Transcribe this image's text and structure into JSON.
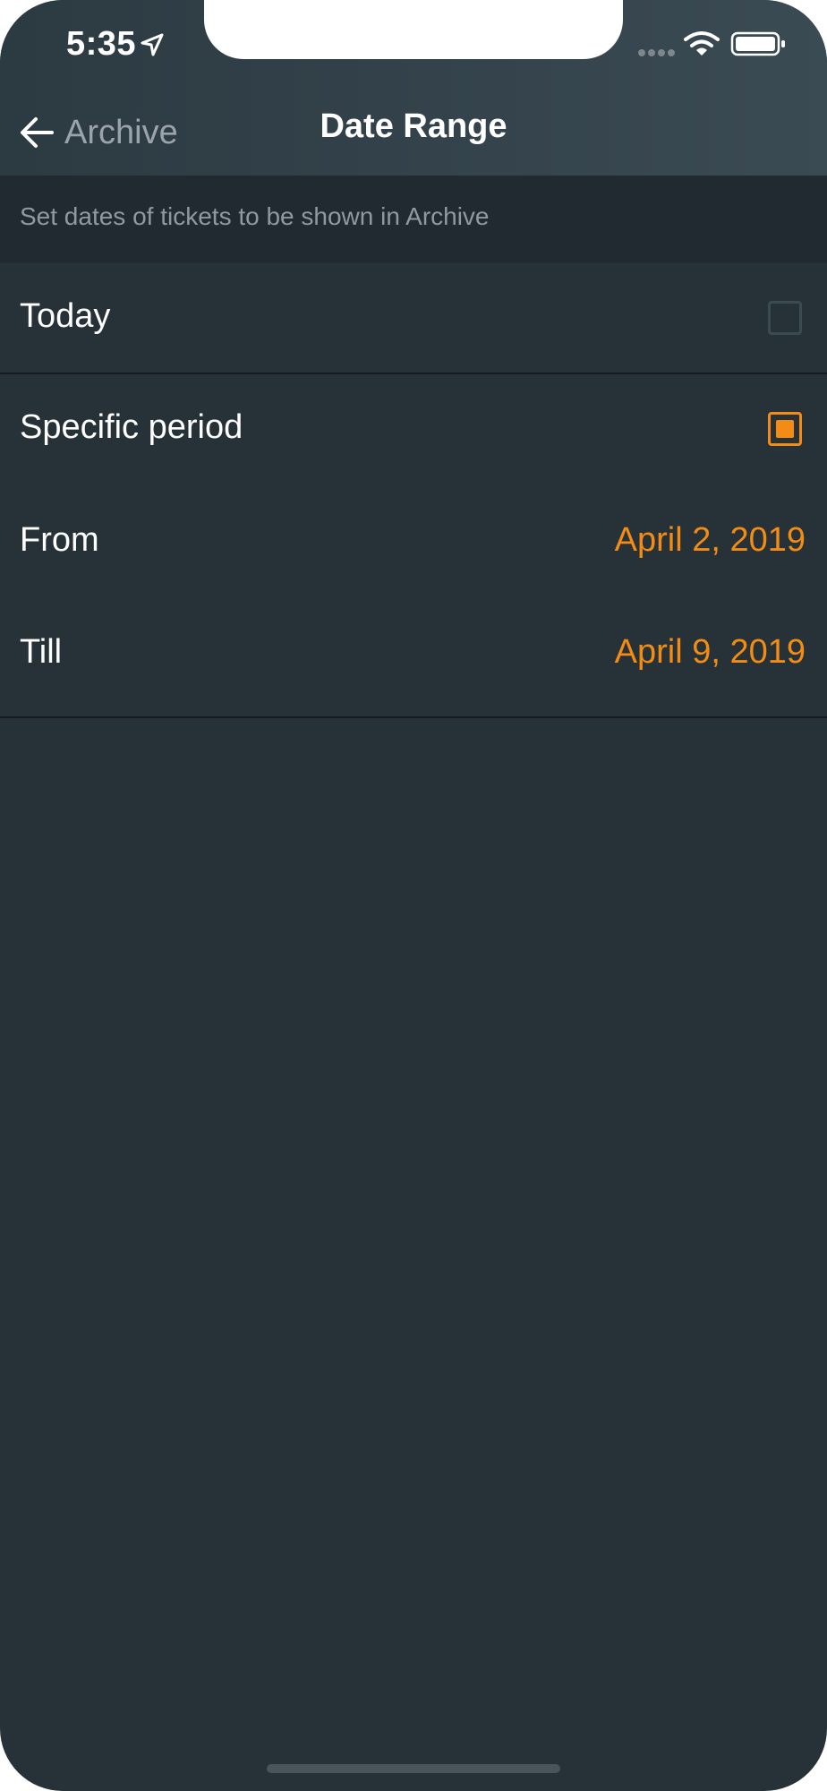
{
  "status_bar": {
    "time": "5:35"
  },
  "nav": {
    "back_label": "Archive",
    "title": "Date Range"
  },
  "description": "Set dates of tickets to be shown in Archive",
  "options": {
    "today": {
      "label": "Today",
      "checked": false
    },
    "specific": {
      "label": "Specific period",
      "checked": true
    }
  },
  "period": {
    "from": {
      "label": "From",
      "value": "April 2, 2019"
    },
    "till": {
      "label": "Till",
      "value": "April 9, 2019"
    }
  },
  "colors": {
    "accent": "#f28c14",
    "background": "#263138",
    "header": "#34444c"
  }
}
